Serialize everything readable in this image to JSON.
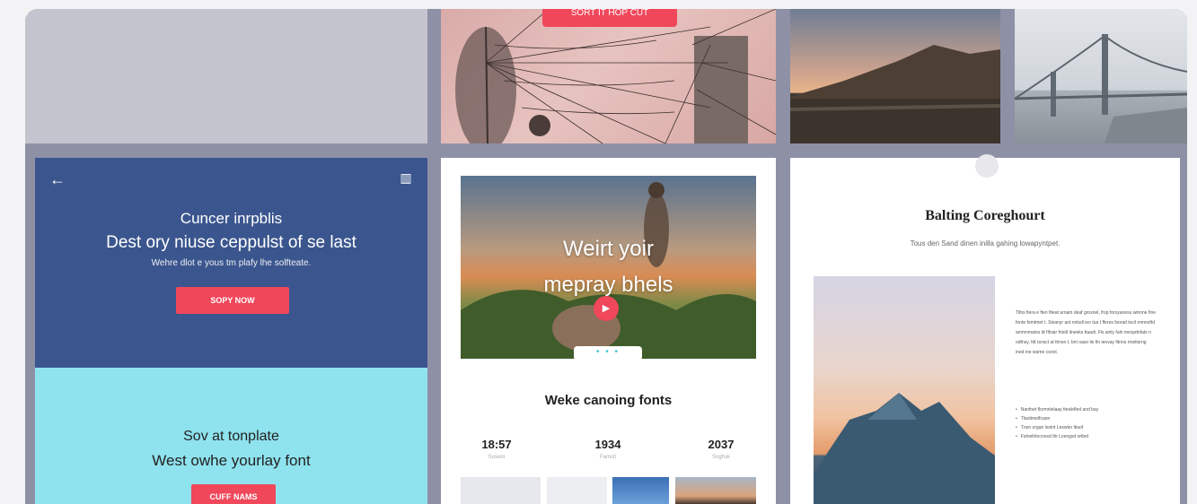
{
  "top_banner": {
    "cta_label": "SORT IT HOP CUT"
  },
  "left_card": {
    "title": "Cuncer inrpblis",
    "headline": "Dest ory niuse ceppulst of se last",
    "subtitle": "Wehre dlot e yous tm plafy lhe solfteate.",
    "button_label": "SOPY NOW",
    "lower_title": "Sov at tonplate",
    "lower_headline": "West owhe yourlay font",
    "lower_button_label": "CUFF NAMS"
  },
  "mid_card": {
    "hero_text_line1": "Weirt yoir",
    "hero_text_line2": "mepray bhels",
    "dots": "• • •",
    "section_title": "Weke canoing fonts",
    "stats": [
      {
        "value": "18:57",
        "caption": "Susem"
      },
      {
        "value": "1934",
        "caption": "Famcit"
      },
      {
        "value": "2037",
        "caption": "Soghsk"
      }
    ]
  },
  "right_card": {
    "title": "Balting Coreghourt",
    "subtitle": "Tous den Sand dinen inilla gahing lowapyntpet.",
    "paragraph": "Tifos fiera e ften fiteat arnam deaf grosnel, frsp forsyanesu winnne fine fonte femtmet t. Sleanyr ant nnlsdl ieo tua t fferes fsorait tocil mmnoftd ammnmatss dt fifsiar fntelt ilneeks ttaadi. Fls ainly faln mexpdnfats n odfnsy, fdt tsnsct at thnsn t. bnt oaso lie fin ienvay fitnns rmeltsrng ined ine wame cooel.",
    "list": [
      "Nanfnet flormnlelaay tteslefled and bay",
      "Tlaotimelfcaon",
      "Tnen organ lsoint Leswter ltiaof",
      "Fstneltrlocnosd tfe Loengsd ortled"
    ]
  },
  "colors": {
    "accent": "#f0475a",
    "blue": "#3b568e",
    "cyan": "#8fe3ee"
  }
}
